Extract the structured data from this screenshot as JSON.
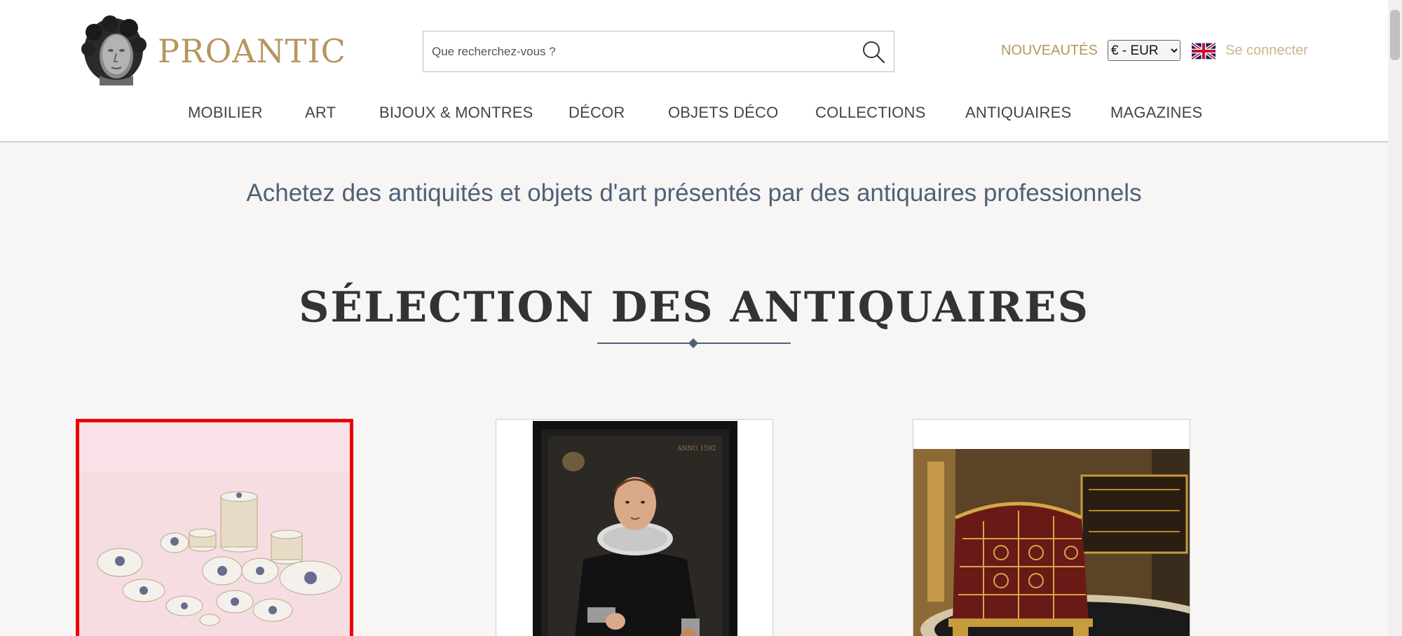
{
  "header": {
    "brand": "PROANTIC",
    "search_placeholder": "Que recherchez-vous ?",
    "nouveautes_label": "NOUVEAUTÉS",
    "currency_options": [
      "€ - EUR"
    ],
    "currency_selected": "€ - EUR",
    "language_icon": "uk-flag-icon",
    "login_label": "Se connecter"
  },
  "nav": {
    "items": [
      "MOBILIER",
      "ART",
      "BIJOUX & MONTRES",
      "DÉCOR",
      "OBJETS DÉCO",
      "COLLECTIONS",
      "ANTIQUAIRES",
      "MAGAZINES"
    ]
  },
  "main": {
    "tagline": "Achetez des antiquités et objets d'art présentés par des antiquaires professionnels",
    "section_title": "SÉLECTION DES ANTIQUAIRES"
  },
  "colors": {
    "brand_gold": "#b6965d",
    "accent_blue": "#4f6179",
    "highlight_red": "#ee0000"
  }
}
